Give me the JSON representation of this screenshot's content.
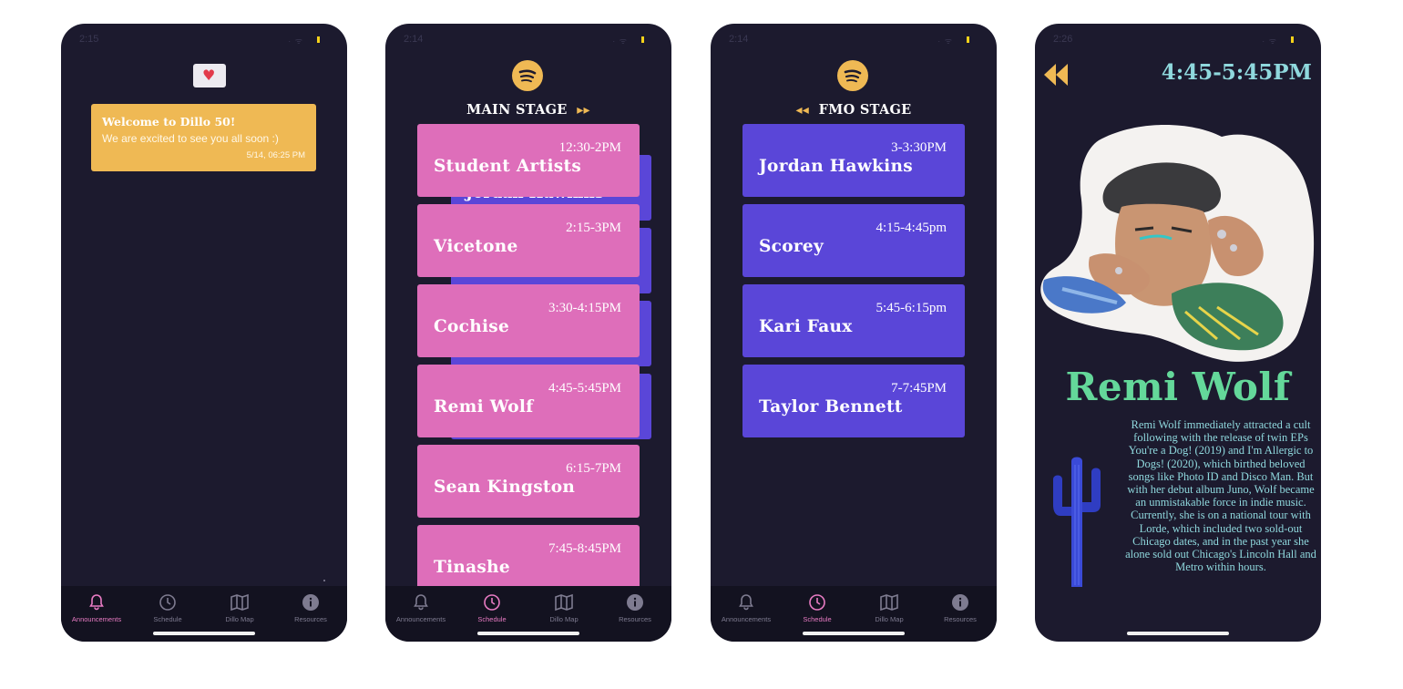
{
  "screens": [
    {
      "status_time": "2:15",
      "announcement": {
        "title": "Welcome to Dillo 50!",
        "body": "We are excited to see you all soon :)",
        "timestamp": "5/14, 06:25 PM"
      }
    },
    {
      "status_time": "2:14",
      "stage_title": "MAIN STAGE",
      "behind_name": "Jordan Hawkins",
      "slots": [
        {
          "time": "12:30-2PM",
          "name": "Student Artists"
        },
        {
          "time": "2:15-3PM",
          "name": "Vicetone"
        },
        {
          "time": "3:30-4:15PM",
          "name": "Cochise"
        },
        {
          "time": "4:45-5:45PM",
          "name": "Remi Wolf"
        },
        {
          "time": "6:15-7PM",
          "name": "Sean Kingston"
        },
        {
          "time": "7:45-8:45PM",
          "name": "Tinashe"
        }
      ]
    },
    {
      "status_time": "2:14",
      "stage_title": "FMO STAGE",
      "slots": [
        {
          "time": "3-3:30PM",
          "name": "Jordan Hawkins"
        },
        {
          "time": "4:15-4:45pm",
          "name": "Scorey"
        },
        {
          "time": "5:45-6:15pm",
          "name": "Kari Faux"
        },
        {
          "time": "7-7:45PM",
          "name": "Taylor Bennett"
        }
      ]
    },
    {
      "status_time": "2:26",
      "time": "4:45-5:45PM",
      "artist": "Remi Wolf",
      "bio": "Remi Wolf immediately attracted a cult following with the release of twin EPs You're a Dog! (2019) and I'm Allergic to Dogs! (2020), which birthed beloved songs like Photo ID and Disco Man. But with her debut album Juno, Wolf became an unmistakable force in indie music. Currently, she is on a national tour with Lorde, which included two sold-out Chicago dates, and in the past year she alone sold out Chicago's Lincoln Hall and Metro within hours."
    }
  ],
  "tabs": [
    {
      "label": "Announcements",
      "icon": "bell-icon"
    },
    {
      "label": "Schedule",
      "icon": "clock-icon"
    },
    {
      "label": "Dillo Map",
      "icon": "map-icon"
    },
    {
      "label": "Resources",
      "icon": "info-icon"
    }
  ],
  "colors": {
    "background": "#1c1a2e",
    "tab_bar": "#131220",
    "accent_yellow": "#efb954",
    "main_stage_pink": "#de6eba",
    "fmo_stage_purple": "#5a46d8",
    "detail_text": "#8fd8dd",
    "artist_name_green": "#64d89a",
    "active_tab": "#e87bc3"
  }
}
